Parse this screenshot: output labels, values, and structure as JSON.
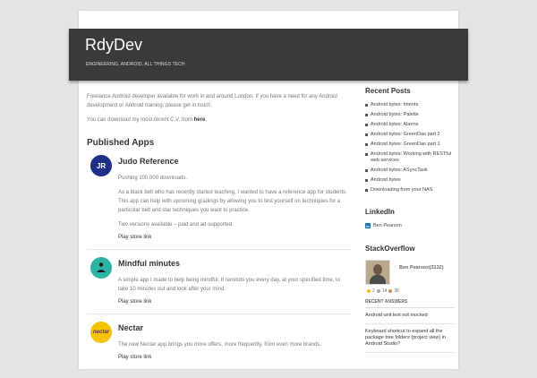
{
  "site": {
    "title": "RdyDev",
    "tagline": "ENGINEERING, ANDROID, ALL THINGS TECH"
  },
  "intro": {
    "p1": "Freelance Android developer available for work in and around London. If you have a need for any Android development or Android training, please get in touch.",
    "p2_prefix": "You can download my most recent C.V. from ",
    "p2_link": "here",
    "p2_suffix": "."
  },
  "apps_section": {
    "title": "Published Apps",
    "apps": [
      {
        "title": "Judo Reference",
        "icon_text": "JR",
        "icon_bg": "#1f2f86",
        "icon_fg": "#ffffff",
        "lines": [
          "Pushing 100,000 downloads.",
          "As a black belt who has recently started teaching, I wanted to have a reference app for students. This app can help with upcoming gradings by allowing you to test yourself on techniques for a particular belt and star techniques you want to practice.",
          "Two versions available – paid and ad-supported."
        ],
        "link": "Play store link"
      },
      {
        "title": "Mindful minutes",
        "icon_text": "",
        "icon_bg": "#2bb3a3",
        "icon_fg": "#1d1d1d",
        "lines": [
          "A simple app I made to help being mindful. It reminds you every day, at your specified time, to take 10 minutes out and look after your mind."
        ],
        "link": "Play store link"
      },
      {
        "title": "Nectar",
        "icon_text": "nectar",
        "icon_bg": "#f7c200",
        "icon_fg": "#5b2a86",
        "lines": [
          "The new Nectar app brings you more offers, more frequently, from even more brands."
        ],
        "link": "Play store link"
      }
    ]
  },
  "sidebar": {
    "recent_posts_title": "Recent Posts",
    "recent_posts": [
      "Android bytes: Intents",
      "Android bytes: Palette",
      "Android bytes: Alarms",
      "Android bytes: GreenDao part 2",
      "Android bytes: GreenDao part 1",
      "Android bytes: Working with RESTful web services",
      "Android bytes: ASyncTask",
      "Android bytes",
      "Downloading from your NAS"
    ],
    "linkedin_title": "LinkedIn",
    "linkedin_icon": "in",
    "linkedin_name": "Ben Pearson",
    "so_title": "StackOverflow",
    "so_user": "Ben Pearson(3132)",
    "so_badges": [
      {
        "count": "2",
        "color": "#f0b400"
      },
      {
        "count": "14",
        "color": "#a8a8a8"
      },
      {
        "count": "36",
        "color": "#c38b5f"
      }
    ],
    "recent_answers_label": "RECENT ANSWERS",
    "recent_answers": [
      "Android unit test not mocked",
      "Keyboard shortcut to expand all the package tree folders (project view) in Android Studio?"
    ]
  }
}
